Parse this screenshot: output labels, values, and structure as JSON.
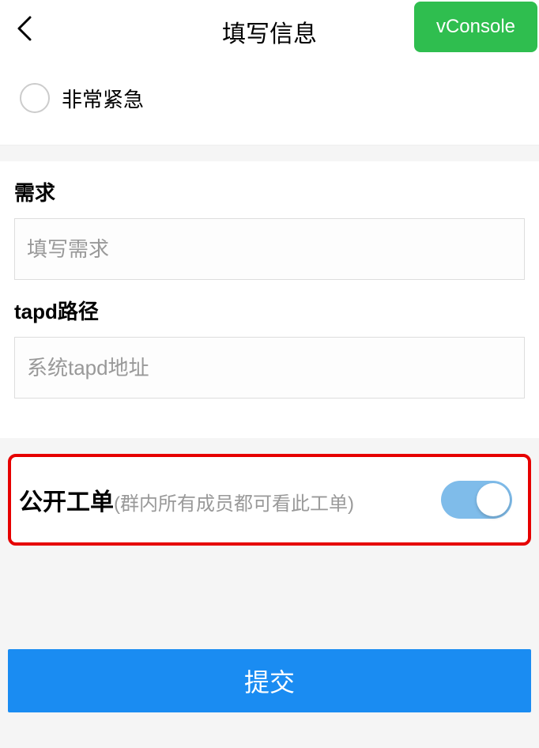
{
  "header": {
    "title": "填写信息",
    "vconsole": "vConsole"
  },
  "radio": {
    "urgent_label": "非常紧急"
  },
  "form": {
    "requirement": {
      "label": "需求",
      "placeholder": "填写需求"
    },
    "tapd": {
      "label": "tapd路径",
      "placeholder": "系统tapd地址"
    }
  },
  "toggle": {
    "title": "公开工单",
    "subtitle": "(群内所有成员都可看此工单)",
    "state": true
  },
  "submit": {
    "label": "提交"
  }
}
